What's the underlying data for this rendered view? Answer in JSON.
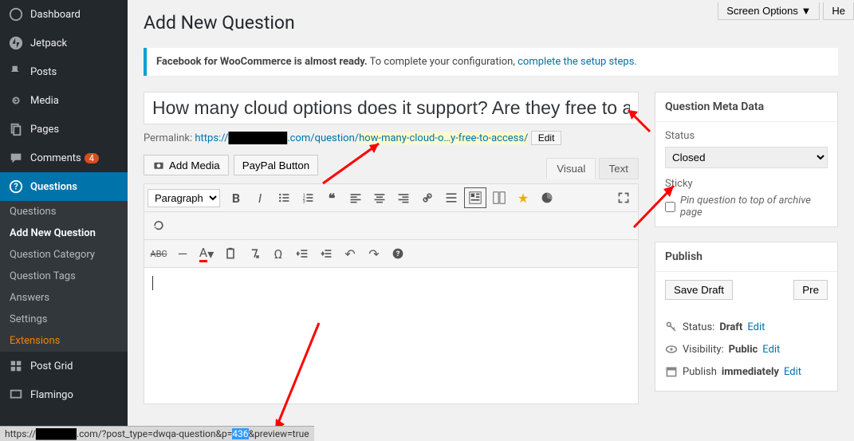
{
  "sidebar": {
    "items": [
      {
        "label": "Dashboard"
      },
      {
        "label": "Jetpack"
      },
      {
        "label": "Posts"
      },
      {
        "label": "Media"
      },
      {
        "label": "Pages"
      },
      {
        "label": "Comments",
        "badge": "4"
      },
      {
        "label": "Questions"
      }
    ],
    "submenu": [
      "Questions",
      "Add New Question",
      "Question Category",
      "Question Tags",
      "Answers",
      "Settings",
      "Extensions"
    ],
    "after": [
      "Post Grid",
      "Flamingo"
    ]
  },
  "topbuttons": {
    "screen_options": "Screen Options ▼",
    "help": "He"
  },
  "page_title": "Add New Question",
  "notice": {
    "bold": "Facebook for WooCommerce is almost ready.",
    "rest": " To complete your configuration, ",
    "link": "complete the setup steps."
  },
  "title_input": "How many cloud options does it support? Are they free to a",
  "permalink": {
    "label": "Permalink: ",
    "prefix": "https://",
    "domain_blackout": "████████",
    "mid": ".com/question/",
    "slug": "how-many-cloud-o…y-free-to-access/",
    "edit": "Edit"
  },
  "media": {
    "add_media": "Add Media",
    "paypal": "PayPal Button"
  },
  "editor_tabs": {
    "visual": "Visual",
    "text": "Text"
  },
  "format_dropdown": "Paragraph",
  "metabox_question": {
    "title": "Question Meta Data",
    "status_label": "Status",
    "status_value": "Closed",
    "sticky_label": "Sticky",
    "sticky_checkbox": "Pin question to top of archive page"
  },
  "publishbox": {
    "title": "Publish",
    "save_draft": "Save Draft",
    "preview": "Pre",
    "status_label": "Status:",
    "status_value": "Draft",
    "status_edit": "Edit",
    "visibility_label": "Visibility:",
    "visibility_value": "Public",
    "visibility_edit": "Edit",
    "schedule_label": "Publish",
    "schedule_value": "immediately",
    "schedule_edit": "Edit"
  },
  "status_bar": {
    "p1": "https://",
    "blackout": "██████",
    "p2": ".com/?post_type=dwqa-question&p=",
    "hl": "436",
    "p3": "&preview=true"
  }
}
